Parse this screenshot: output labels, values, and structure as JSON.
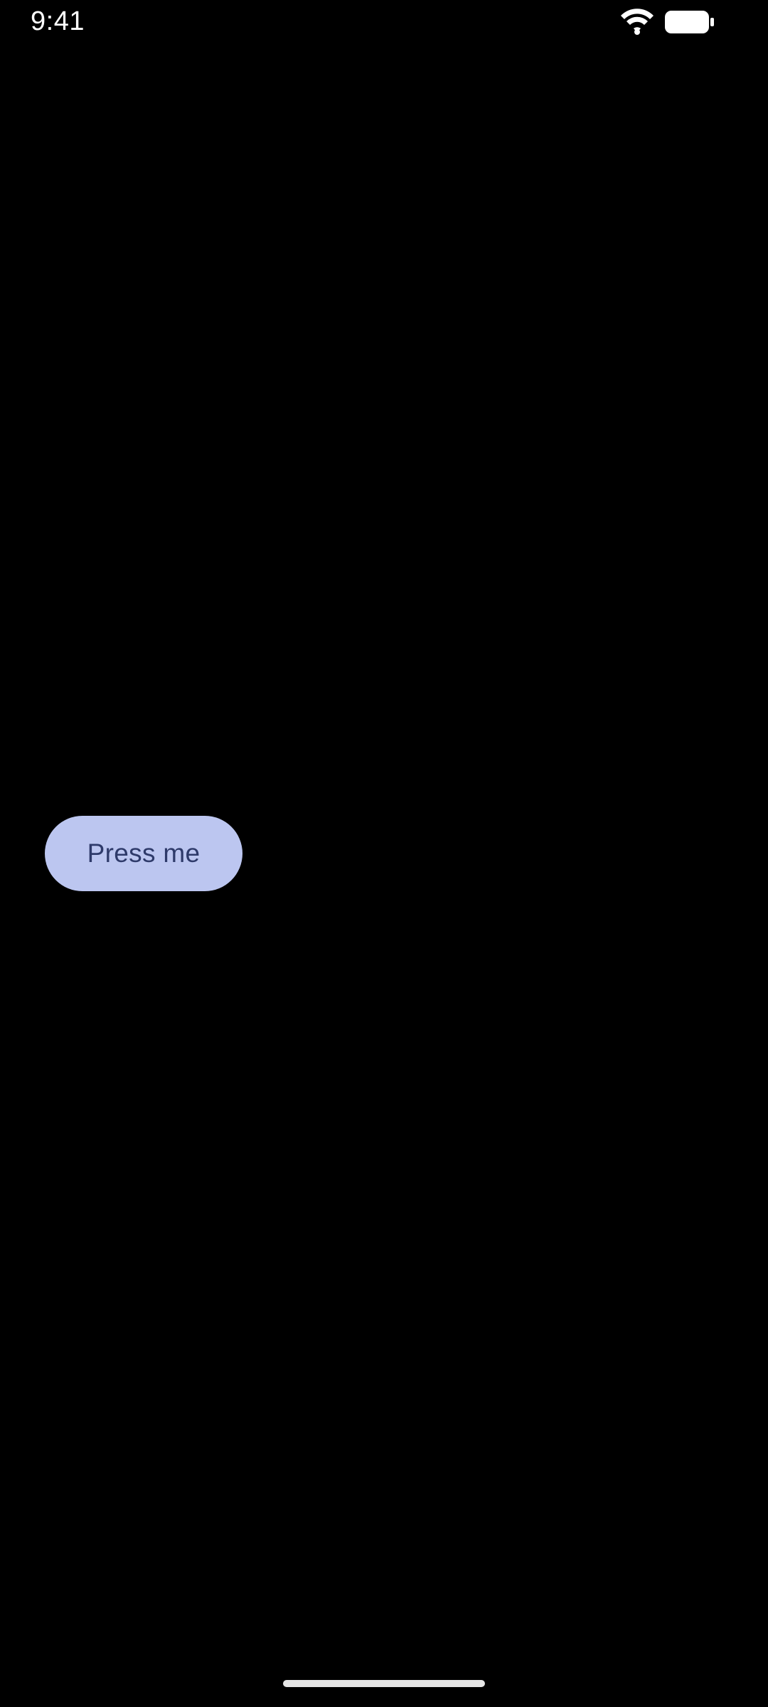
{
  "status_bar": {
    "time": "9:41",
    "wifi_icon": "wifi-icon",
    "battery_icon": "battery-icon"
  },
  "main": {
    "button_label": "Press me"
  },
  "colors": {
    "background": "#000000",
    "button_bg": "#bcc6f0",
    "button_text": "#2e3a6a",
    "status_text": "#ffffff"
  }
}
